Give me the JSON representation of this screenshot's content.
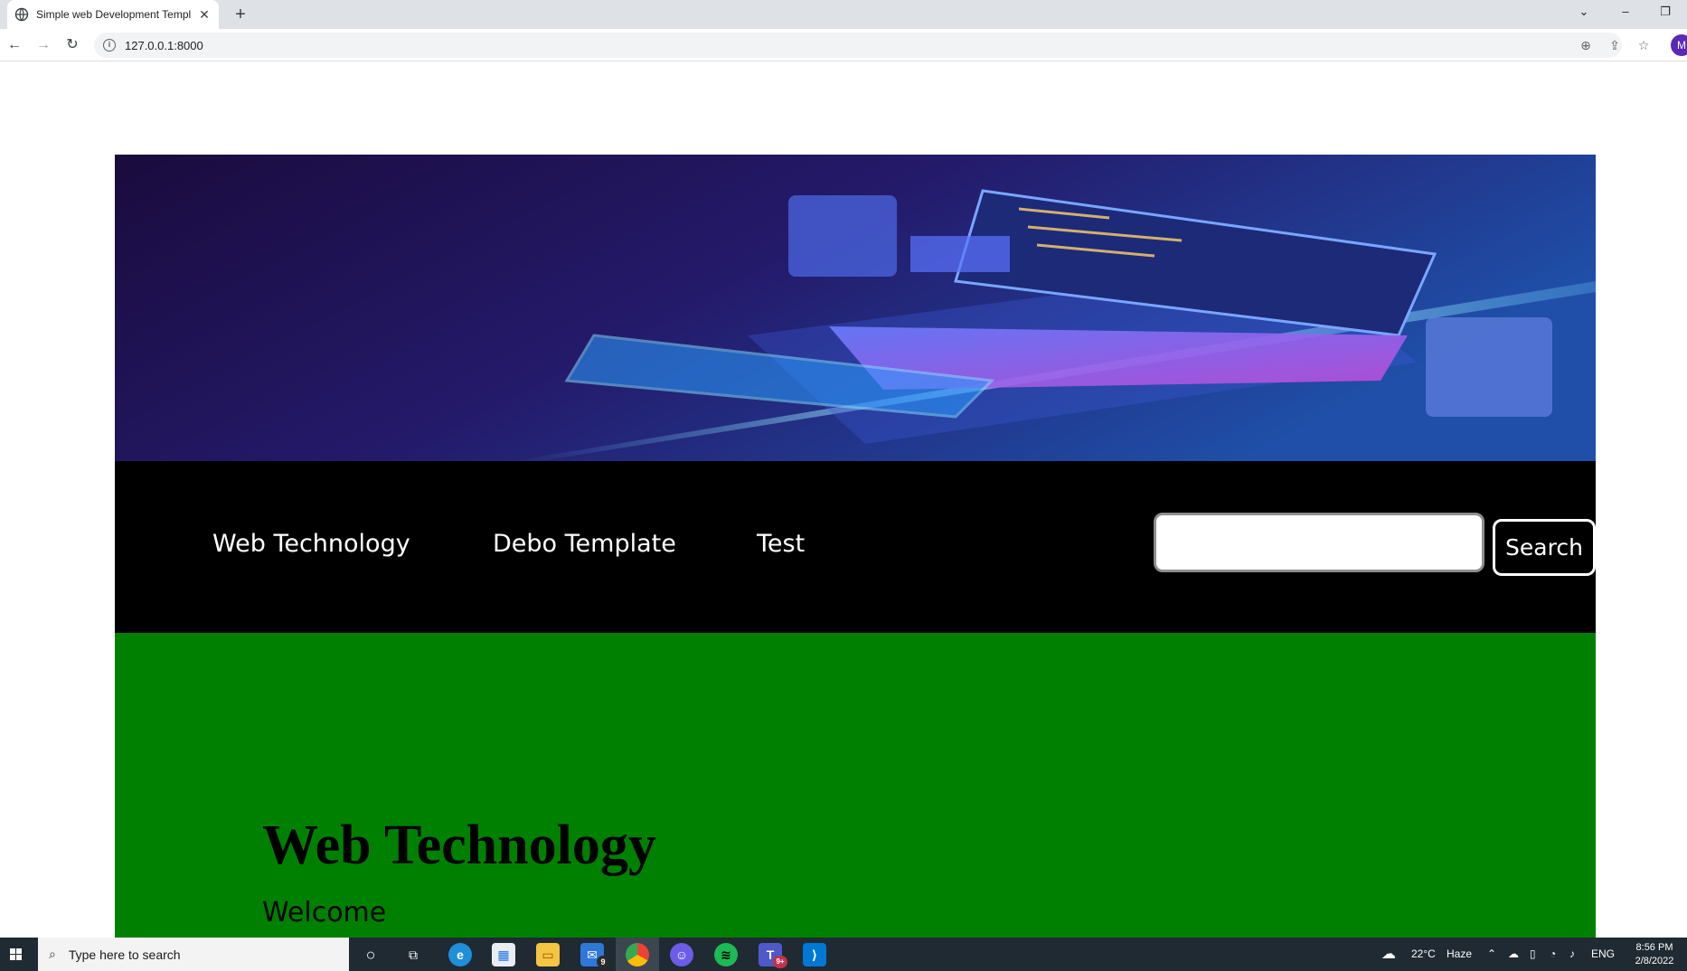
{
  "browser": {
    "tab_title": "Simple web Development Templ",
    "url": "127.0.0.1:8000",
    "profile_initial": "M"
  },
  "page": {
    "nav_links": [
      "Web Technology",
      "Debo Template",
      "Test"
    ],
    "search_value": "",
    "search_button": "Search",
    "heading": "Web Technology",
    "subtext": "Welcome",
    "colors": {
      "navbar": "#000000",
      "content": "#008000"
    }
  },
  "taskbar": {
    "search_placeholder": "Type here to search",
    "weather_temp": "22°C",
    "weather_text": "Haze",
    "language": "ENG",
    "time": "8:56 PM",
    "date": "2/8/2022",
    "mail_badge": "9",
    "teams_badge": "9+"
  }
}
